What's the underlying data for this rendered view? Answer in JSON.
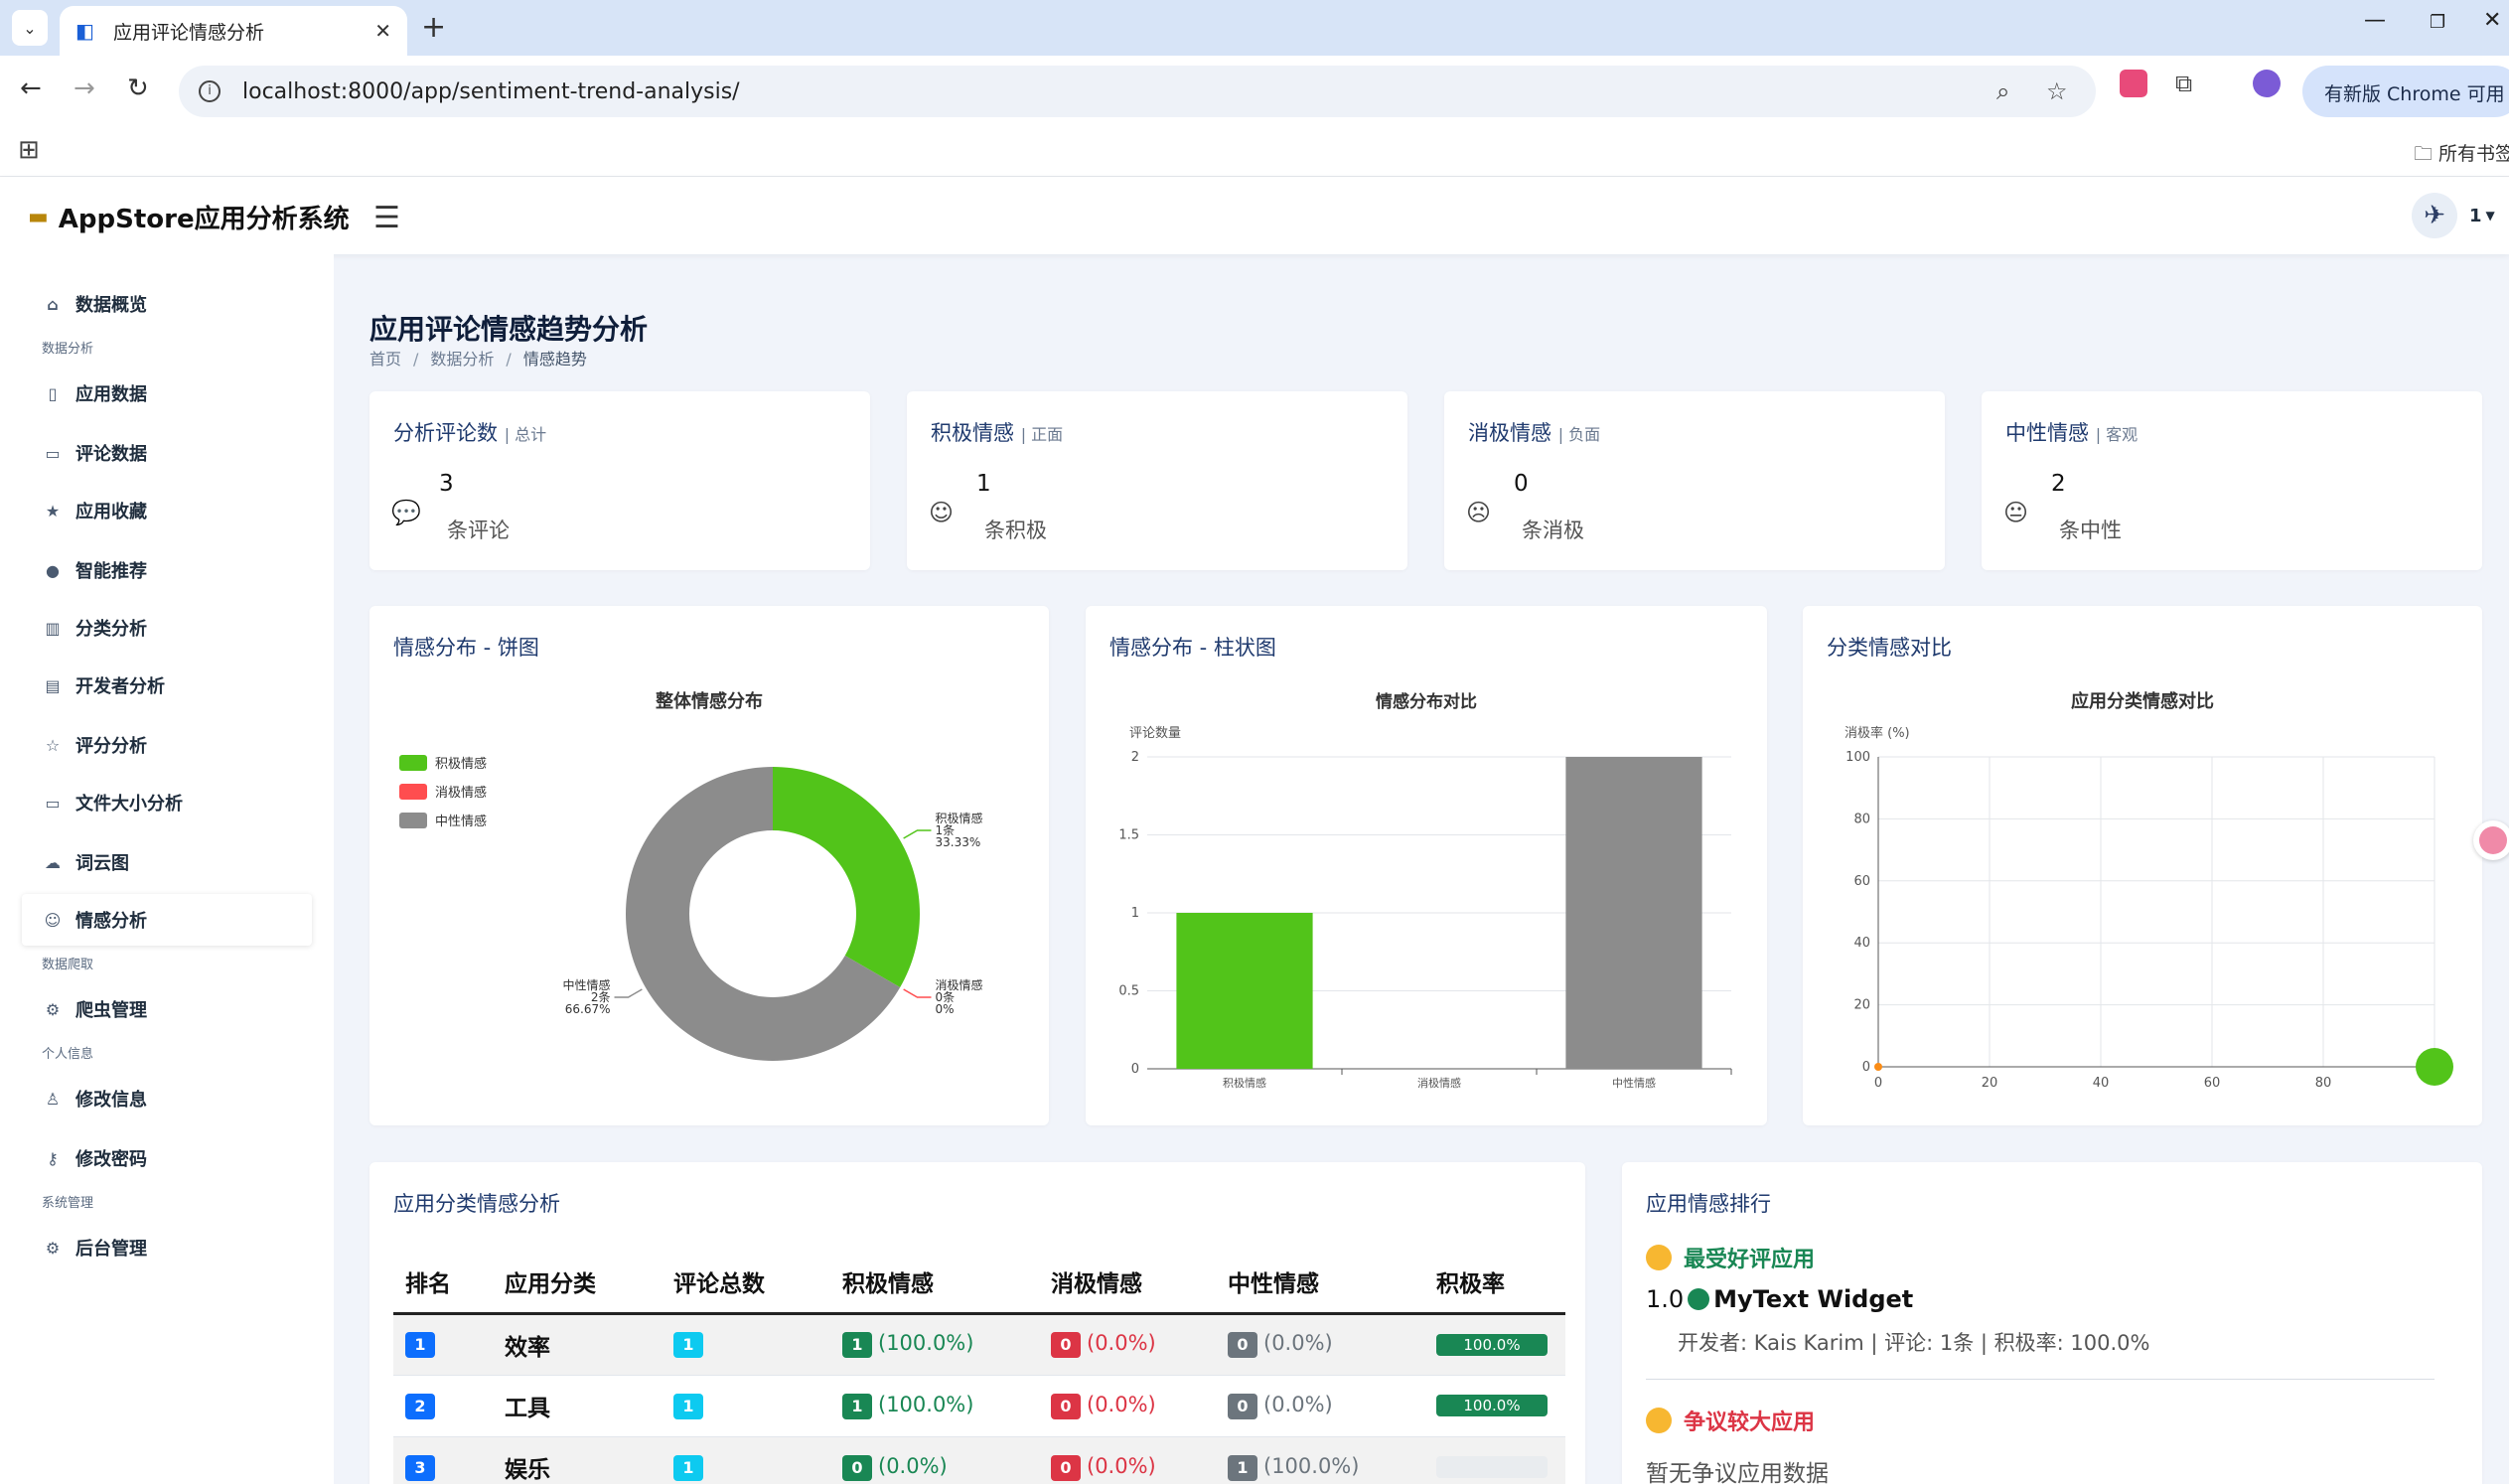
{
  "browser": {
    "tab_title": "应用评论情感分析",
    "url": "localhost:8000/app/sentiment-trend-analysis/",
    "update_label": "有新版 Chrome 可用",
    "bookmarks_label": "所有书签"
  },
  "app": {
    "brand": "AppStore应用分析系统",
    "user": "1"
  },
  "sidebar": {
    "overview": "数据概览",
    "section_analysis": "数据分析",
    "items": [
      "应用数据",
      "评论数据",
      "应用收藏",
      "智能推荐",
      "分类分析",
      "开发者分析",
      "评分分析",
      "文件大小分析",
      "词云图",
      "情感分析"
    ],
    "section_crawl": "数据爬取",
    "crawler": "爬虫管理",
    "section_personal": "个人信息",
    "edit_info": "修改信息",
    "edit_password": "修改密码",
    "section_system": "系统管理",
    "admin": "后台管理"
  },
  "page": {
    "title": "应用评论情感趋势分析",
    "breadcrumb": [
      "首页",
      "数据分析",
      "情感趋势"
    ]
  },
  "stats": [
    {
      "title": "分析评论数",
      "sub": "总计",
      "value": "3",
      "unit": "条评论",
      "icon": "comment-icon"
    },
    {
      "title": "积极情感",
      "sub": "正面",
      "value": "1",
      "unit": "条积极",
      "icon": "smile-icon"
    },
    {
      "title": "消极情感",
      "sub": "负面",
      "value": "0",
      "unit": "条消极",
      "icon": "frown-icon"
    },
    {
      "title": "中性情感",
      "sub": "客观",
      "value": "2",
      "unit": "条中性",
      "icon": "neutral-icon"
    }
  ],
  "panels": {
    "pie": "情感分布 - 饼图",
    "bar": "情感分布 - 柱状图",
    "scatter": "分类情感对比",
    "table": "应用分类情感分析",
    "ranking": "应用情感排行"
  },
  "colors": {
    "positive": "#52c41a",
    "negative": "#ff4d4f",
    "neutral": "#8c8c8c"
  },
  "chart_data": [
    {
      "type": "pie",
      "title": "整体情感分布",
      "legend": [
        "积极情感",
        "消极情感",
        "中性情感"
      ],
      "legend_position": "top-left",
      "slices": [
        {
          "name": "积极情感",
          "value": 1,
          "label": "1条",
          "percent": "33.33%"
        },
        {
          "name": "消极情感",
          "value": 0,
          "label": "0条",
          "percent": "0%"
        },
        {
          "name": "中性情感",
          "value": 2,
          "label": "2条",
          "percent": "66.67%"
        }
      ]
    },
    {
      "type": "bar",
      "title": "情感分布对比",
      "ylabel": "评论数量",
      "categories": [
        "积极情感",
        "消极情感",
        "中性情感"
      ],
      "values": [
        1,
        0,
        2
      ],
      "ylim": [
        0,
        2
      ],
      "yticks": [
        "0",
        "0.5",
        "1",
        "1.5",
        "2"
      ],
      "grid": true
    },
    {
      "type": "scatter",
      "title": "应用分类情感对比",
      "ylabel": "消极率 (%)",
      "xlim": [
        0,
        100
      ],
      "ylim": [
        0,
        100
      ],
      "xticks": [
        "0",
        "20",
        "40",
        "60",
        "80"
      ],
      "yticks": [
        "0",
        "20",
        "40",
        "60",
        "80",
        "100"
      ],
      "grid": true,
      "points": [
        {
          "x": 0,
          "y": 0,
          "size": "small",
          "color": "#fa8c16"
        },
        {
          "x": 100,
          "y": 0,
          "size": "large",
          "color": "#52c41a"
        }
      ]
    }
  ],
  "table": {
    "headers": [
      "排名",
      "应用分类",
      "评论总数",
      "积极情感",
      "消极情感",
      "中性情感",
      "积极率"
    ],
    "rows": [
      {
        "rank": "1",
        "category": "效率",
        "total": "1",
        "pos": "1",
        "pos_pct": "(100.0%)",
        "neg": "0",
        "neg_pct": "(0.0%)",
        "neu": "0",
        "neu_pct": "(0.0%)",
        "rate": 100,
        "rate_label": "100.0%"
      },
      {
        "rank": "2",
        "category": "工具",
        "total": "1",
        "pos": "1",
        "pos_pct": "(100.0%)",
        "neg": "0",
        "neg_pct": "(0.0%)",
        "neu": "0",
        "neu_pct": "(0.0%)",
        "rate": 100,
        "rate_label": "100.0%"
      },
      {
        "rank": "3",
        "category": "娱乐",
        "total": "1",
        "pos": "0",
        "pos_pct": "(0.0%)",
        "neg": "0",
        "neg_pct": "(0.0%)",
        "neu": "1",
        "neu_pct": "(100.0%)",
        "rate": 0,
        "rate_label": ""
      }
    ]
  },
  "ranking": {
    "best_title": "最受好评应用",
    "best_score": "1.0",
    "best_app": "MyText Widget",
    "best_meta": "开发者: Kais Karim | 评论: 1条 | 积极率: 100.0%",
    "controversial_title": "争议较大应用",
    "controversial_empty": "暂无争议应用数据"
  }
}
